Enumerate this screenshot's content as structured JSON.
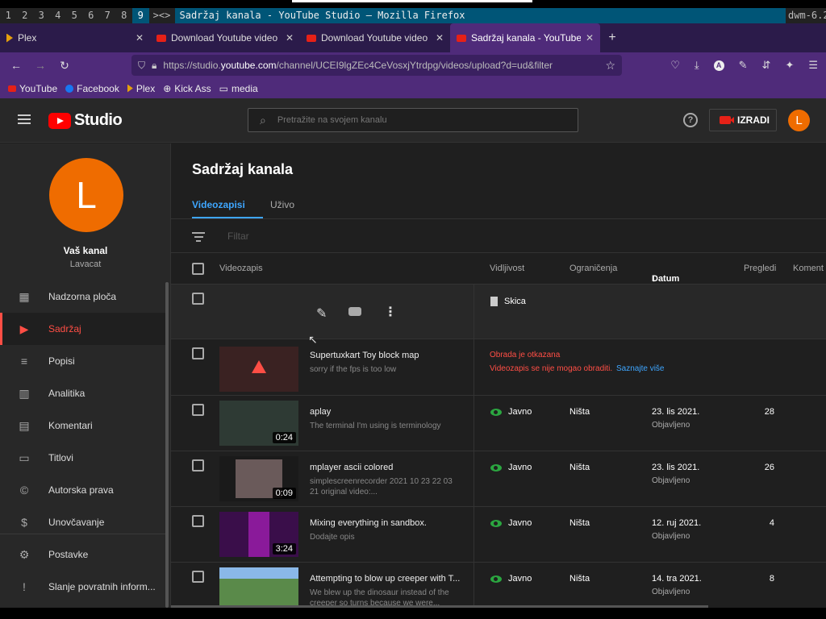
{
  "dwm": {
    "tags": [
      "1",
      "2",
      "3",
      "4",
      "5",
      "6",
      "7",
      "8",
      "9"
    ],
    "layout": "><>",
    "window_title": "Sadržaj kanala - YouTube Studio — Mozilla Firefox",
    "status": "dwm-6.2"
  },
  "firefox": {
    "tabs": [
      {
        "label": "Plex"
      },
      {
        "label": "Download Youtube video"
      },
      {
        "label": "Download Youtube video"
      },
      {
        "label": "Sadržaj kanala - YouTube"
      }
    ],
    "url_prefix": "https://studio.",
    "url_domain": "youtube.com",
    "url_rest": "/channel/UCEI9lgZEc4CeVosxjYtrdpg/videos/upload?d=ud&filter",
    "bookmarks": [
      {
        "label": "YouTube",
        "color": "#e62117"
      },
      {
        "label": "Facebook",
        "color": "#1877f2"
      },
      {
        "label": "Plex",
        "color": "#e5a00d"
      },
      {
        "label": "Kick Ass",
        "color": "#cccccc"
      },
      {
        "label": "media",
        "color": "#cccccc"
      }
    ]
  },
  "studio": {
    "logo_text": "Studio",
    "search_placeholder": "Pretražite na svojem kanalu",
    "create_label": "IZRADI",
    "avatar_letter": "L",
    "channel_title": "Vaš kanal",
    "channel_handle": "Lavacat",
    "nav": [
      {
        "label": "Nadzorna ploča",
        "icon": "dashboard-icon"
      },
      {
        "label": "Sadržaj",
        "icon": "content-icon"
      },
      {
        "label": "Popisi",
        "icon": "playlists-icon"
      },
      {
        "label": "Analitika",
        "icon": "analytics-icon"
      },
      {
        "label": "Komentari",
        "icon": "comments-icon"
      },
      {
        "label": "Titlovi",
        "icon": "subtitles-icon"
      },
      {
        "label": "Autorska prava",
        "icon": "copyright-icon"
      },
      {
        "label": "Unovčavanje",
        "icon": "dollar-icon"
      },
      {
        "label": "Postavke",
        "icon": "settings-icon"
      },
      {
        "label": "Slanje povratnih inform...",
        "icon": "feedback-icon"
      }
    ],
    "page_title": "Sadržaj kanala",
    "tabs": [
      "Videozapisi",
      "Uživo"
    ],
    "filter_placeholder": "Filtar",
    "columns": {
      "video": "Videozapis",
      "visibility": "Vidljivost",
      "restrictions": "Ograničenja",
      "date": "Datum",
      "views": "Pregledi",
      "comments": "Koment"
    },
    "draft_row": {
      "visibility": "Skica"
    },
    "error_row": {
      "title": "Supertuxkart Toy block map",
      "desc": "sorry if the fps is too low",
      "error1": "Obrada je otkazana",
      "error2": "Videozapis se nije mogao obraditi.",
      "learn_more": "Saznajte više"
    },
    "videos": [
      {
        "title": "aplay",
        "desc": "The terminal I'm using is terminology",
        "duration": "0:24",
        "visibility": "Javno",
        "restrictions": "Ništa",
        "date": "23. lis 2021.",
        "status": "Objavljeno",
        "views": "28"
      },
      {
        "title": "mplayer ascii colored",
        "desc": "simplescreenrecorder 2021 10 23 22 03 21 original video:...",
        "duration": "0:09",
        "visibility": "Javno",
        "restrictions": "Ništa",
        "date": "23. lis 2021.",
        "status": "Objavljeno",
        "views": "26"
      },
      {
        "title": "Mixing everything in sandbox.",
        "desc": "Dodajte opis",
        "duration": "3:24",
        "visibility": "Javno",
        "restrictions": "Ništa",
        "date": "12. ruj 2021.",
        "status": "Objavljeno",
        "views": "4"
      },
      {
        "title": "Attempting to blow up creeper with T...",
        "desc": "We blew up the dinosaur instead of the creeper so turns because we were...",
        "duration": "",
        "visibility": "Javno",
        "restrictions": "Ništa",
        "date": "14. tra 2021.",
        "status": "Objavljeno",
        "views": "8"
      }
    ]
  }
}
